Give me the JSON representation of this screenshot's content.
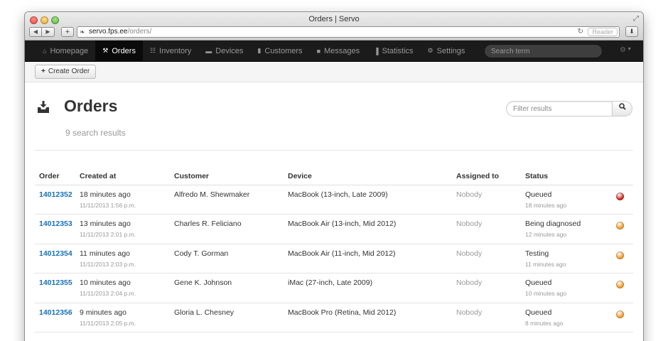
{
  "window": {
    "title": "Orders | Servo"
  },
  "browser": {
    "url_host": "servo.fps.ee",
    "url_path": "/orders/",
    "reader_label": "Reader"
  },
  "nav": {
    "items": [
      {
        "label": "Homepage",
        "icon": "home-icon",
        "glyph": "⌂"
      },
      {
        "label": "Orders",
        "icon": "wrench-icon",
        "glyph": "⚒"
      },
      {
        "label": "Inventory",
        "icon": "cart-icon",
        "glyph": "☷"
      },
      {
        "label": "Devices",
        "icon": "device-icon",
        "glyph": "▬"
      },
      {
        "label": "Customers",
        "icon": "book-icon",
        "glyph": "▮"
      },
      {
        "label": "Messages",
        "icon": "message-icon",
        "glyph": "■"
      },
      {
        "label": "Statistics",
        "icon": "bars-icon",
        "glyph": "▐"
      },
      {
        "label": "Settings",
        "icon": "gear-icon",
        "glyph": "⚙"
      }
    ],
    "active_index": 1,
    "search_placeholder": "Search term"
  },
  "toolbar": {
    "create_label": "Create Order"
  },
  "page": {
    "title": "Orders",
    "subtitle": "9 search results",
    "filter_placeholder": "Filter results"
  },
  "table": {
    "headers": [
      "Order",
      "Created at",
      "Customer",
      "Device",
      "Assigned to",
      "Status"
    ],
    "rows": [
      {
        "order": "14012352",
        "created": "18 minutes ago",
        "created_date": "11/11/2013 1:56 p.m.",
        "customer": "Alfredo M. Shewmaker",
        "device": "MacBook (13-inch, Late 2009)",
        "assigned": "Nobody",
        "status": "Queued",
        "status_time": "18 minutes ago",
        "status_color": "#cc2a1e"
      },
      {
        "order": "14012353",
        "created": "13 minutes ago",
        "created_date": "11/11/2013 2:01 p.m.",
        "customer": "Charles R. Feliciano",
        "device": "MacBook Air (13-inch, Mid 2012)",
        "assigned": "Nobody",
        "status": "Being diagnosed",
        "status_time": "12 minutes ago",
        "status_color": "#f39a2a"
      },
      {
        "order": "14012354",
        "created": "11 minutes ago",
        "created_date": "11/11/2013 2:03 p.m.",
        "customer": "Cody T. Gorman",
        "device": "MacBook Air (11-inch, Mid 2012)",
        "assigned": "Nobody",
        "status": "Testing",
        "status_time": "11 minutes ago",
        "status_color": "#f39a2a"
      },
      {
        "order": "14012355",
        "created": "10 minutes ago",
        "created_date": "11/11/2013 2:04 p.m.",
        "customer": "Gene K. Johnson",
        "device": "iMac (27-inch, Late 2009)",
        "assigned": "Nobody",
        "status": "Queued",
        "status_time": "10 minutes ago",
        "status_color": "#f39a2a"
      },
      {
        "order": "14012356",
        "created": "9 minutes ago",
        "created_date": "11/11/2013 2:05 p.m.",
        "customer": "Gloria L. Chesney",
        "device": "MacBook Pro (Retina, Mid 2012)",
        "assigned": "Nobody",
        "status": "Queued",
        "status_time": "8 minutes ago",
        "status_color": "#f39a2a"
      }
    ]
  }
}
